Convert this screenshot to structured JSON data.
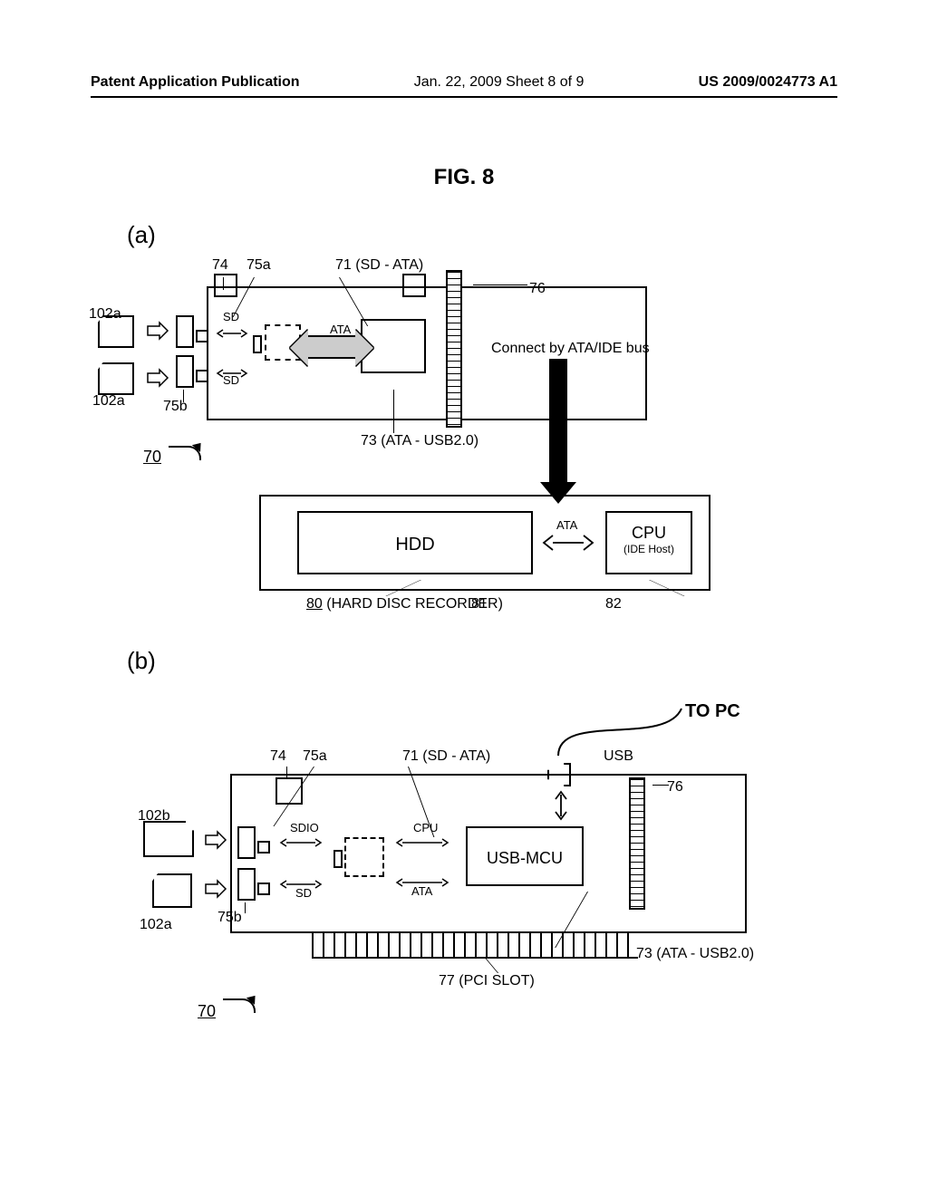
{
  "header": {
    "left": "Patent Application Publication",
    "mid": "Jan. 22, 2009  Sheet 8 of 9",
    "right": "US 2009/0024773 A1"
  },
  "figure_title": "FIG. 8",
  "sections": {
    "a": "(a)",
    "b": "(b)"
  },
  "diag_a": {
    "ref": {
      "r74": "74",
      "r75a": "75a",
      "r71": "71 (SD - ATA)",
      "r76": "76",
      "r73": "73 (ATA - USB2.0)",
      "r75b": "75b",
      "r102a": "102a",
      "r70": "70"
    },
    "lbl": {
      "sd_top": "SD",
      "sd_bot": "SD",
      "ata": "ATA",
      "connect": "Connect by ATA/IDE bus"
    },
    "recorder": {
      "hdd": "HDD",
      "cpu": "CPU",
      "cpu_sub": "(IDE Host)",
      "ata": "ATA",
      "label": "(HARD DISC RECORDER)",
      "r80": "80",
      "r81": "81",
      "r82": "82"
    }
  },
  "diag_b": {
    "ref": {
      "r74": "74",
      "r75a": "75a",
      "r71": "71 (SD - ATA)",
      "r76": "76",
      "r73": "73 (ATA - USB2.0)",
      "r77": "77 (PCI SLOT)",
      "r75b": "75b",
      "r70": "70",
      "r102b": "102b",
      "r102a": "102a"
    },
    "lbl": {
      "sdio": "SDIO",
      "sd": "SD",
      "cpu": "CPU",
      "ata": "ATA",
      "usbmcu": "USB-MCU",
      "usb": "USB",
      "topc": "TO PC"
    }
  }
}
